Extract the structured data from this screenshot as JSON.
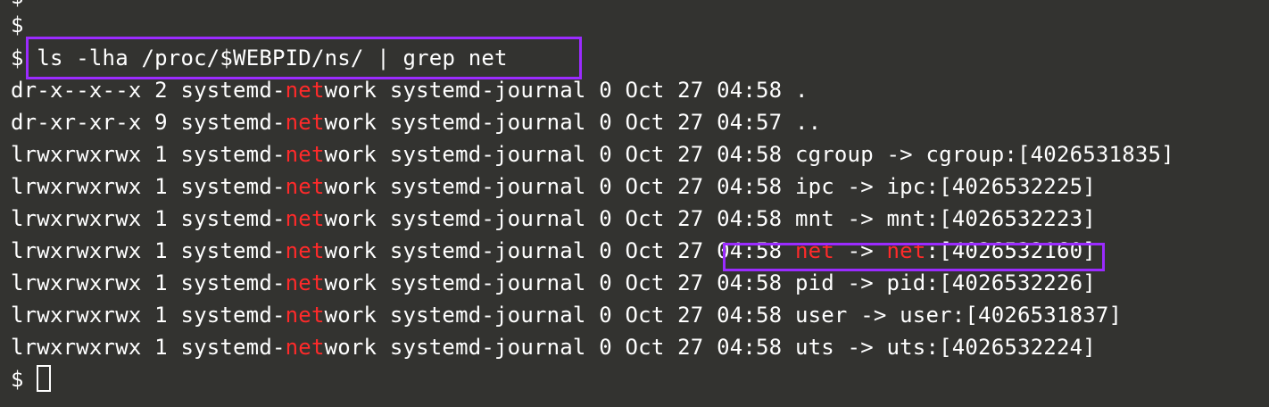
{
  "prompt": "$",
  "command": "ls -lha /proc/$WEBPID/ns/ | grep net",
  "rows": [
    {
      "pre": "dr-x--x--x 2 systemd-",
      "hl": "net",
      "post": "work systemd-journal 0 Oct 27 04:58 ."
    },
    {
      "pre": "dr-xr-xr-x 9 systemd-",
      "hl": "net",
      "post": "work systemd-journal 0 Oct 27 04:57 .."
    },
    {
      "pre": "lrwxrwxrwx 1 systemd-",
      "hl": "net",
      "post": "work systemd-journal 0 Oct 27 04:58 cgroup -> cgroup:[4026531835]"
    },
    {
      "pre": "lrwxrwxrwx 1 systemd-",
      "hl": "net",
      "post": "work systemd-journal 0 Oct 27 04:58 ipc -> ipc:[4026532225]"
    },
    {
      "pre": "lrwxrwxrwx 1 systemd-",
      "hl": "net",
      "post": "work systemd-journal 0 Oct 27 04:58 mnt -> mnt:[4026532223]"
    },
    {
      "pre": "lrwxrwxrwx 1 systemd-",
      "hl": "net",
      "post": "work systemd-journal 0 Oct 27 04:58 ",
      "hl2": "net",
      "mid": " -> ",
      "hl3": "net",
      "post2": ":[4026532160]"
    },
    {
      "pre": "lrwxrwxrwx 1 systemd-",
      "hl": "net",
      "post": "work systemd-journal 0 Oct 27 04:58 pid -> pid:[4026532226]"
    },
    {
      "pre": "lrwxrwxrwx 1 systemd-",
      "hl": "net",
      "post": "work systemd-journal 0 Oct 27 04:58 user -> user:[4026531837]"
    },
    {
      "pre": "lrwxrwxrwx 1 systemd-",
      "hl": "net",
      "post": "work systemd-journal 0 Oct 27 04:58 uts -> uts:[4026532224]"
    }
  ],
  "colors": {
    "background": "#333330",
    "text": "#ffffff",
    "match": "#ff2a2a",
    "annotation": "#9b2bff"
  }
}
